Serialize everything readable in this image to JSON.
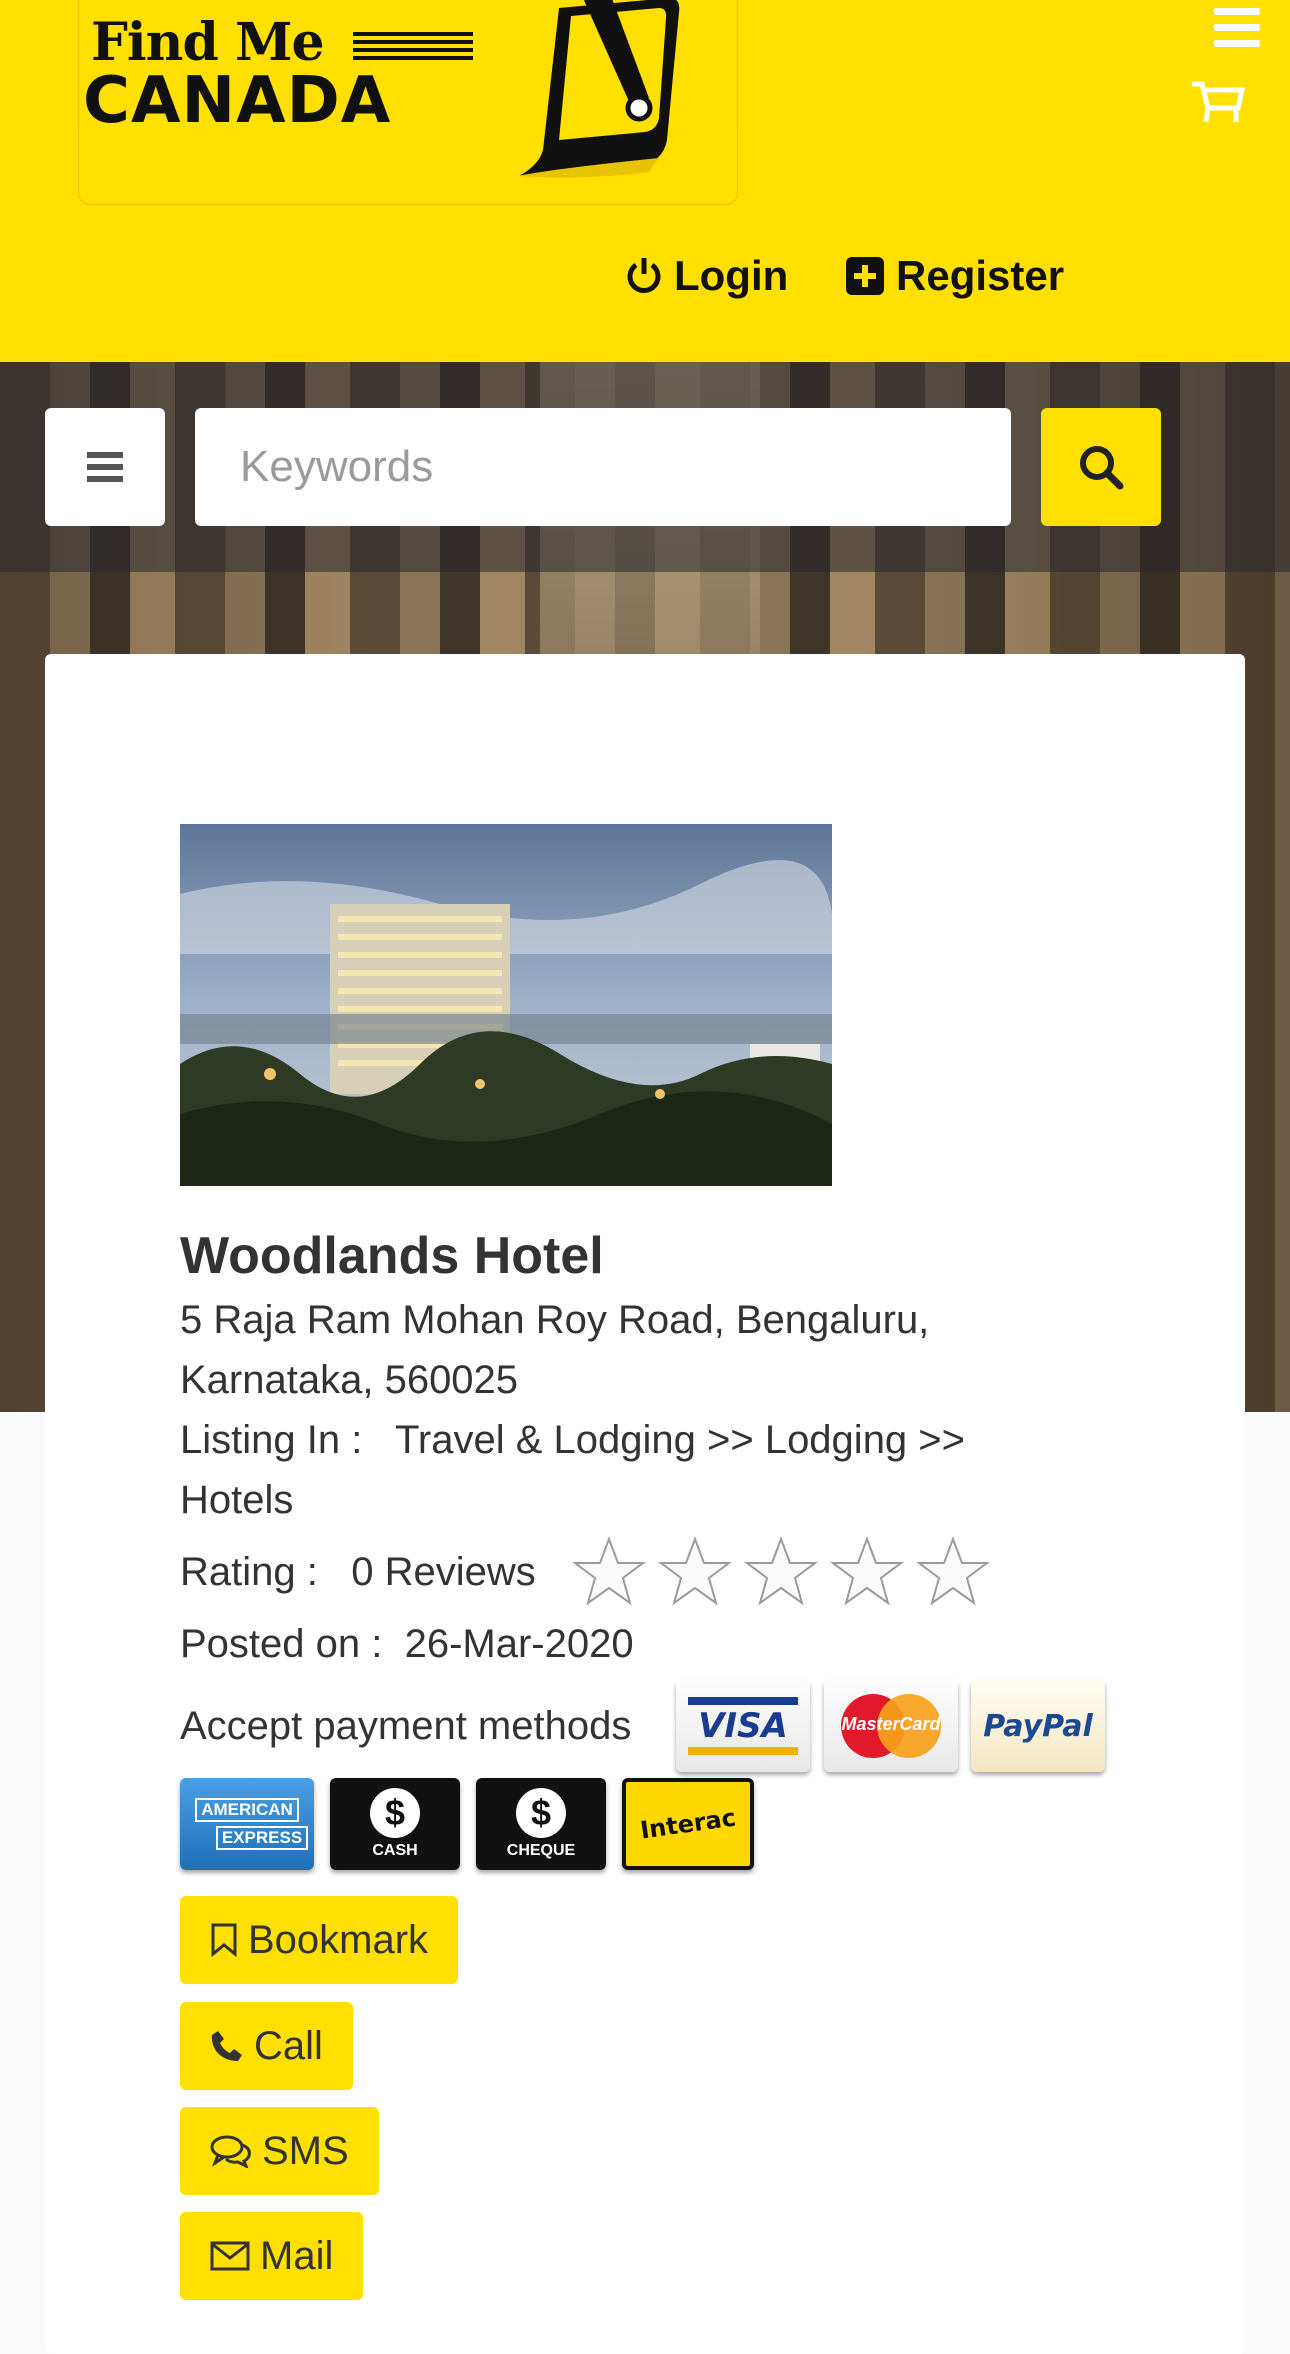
{
  "header": {
    "logo_line1": "Find Me",
    "logo_line2": "CANADA",
    "login_label": "Login",
    "register_label": "Register"
  },
  "search": {
    "placeholder": "Keywords"
  },
  "listing": {
    "name": "Woodlands Hotel",
    "address": "5 Raja Ram Mohan Roy Road, Bengaluru, Karnataka, 560025",
    "listing_in_label": "Listing In :",
    "listing_in_path": "Travel & Lodging >> Lodging >> Hotels",
    "rating_label": "Rating :",
    "reviews": "0 Reviews",
    "rating_value": 0,
    "rating_max": 5,
    "posted_label": "Posted on :",
    "posted_date": "26-Mar-2020",
    "payment_label": "Accept payment methods"
  },
  "payments": {
    "visa": "VISA",
    "mastercard": "MasterCard",
    "paypal": "PayPal",
    "amex_line1": "AMERICAN",
    "amex_line2": "EXPRESS",
    "cash": "CASH",
    "cheque": "CHEQUE",
    "interac": "Interac"
  },
  "actions": {
    "bookmark": "Bookmark",
    "call": "Call",
    "sms": "SMS",
    "mail": "Mail"
  },
  "colors": {
    "brand_yellow": "#ffe000",
    "text_dark": "#333333"
  }
}
